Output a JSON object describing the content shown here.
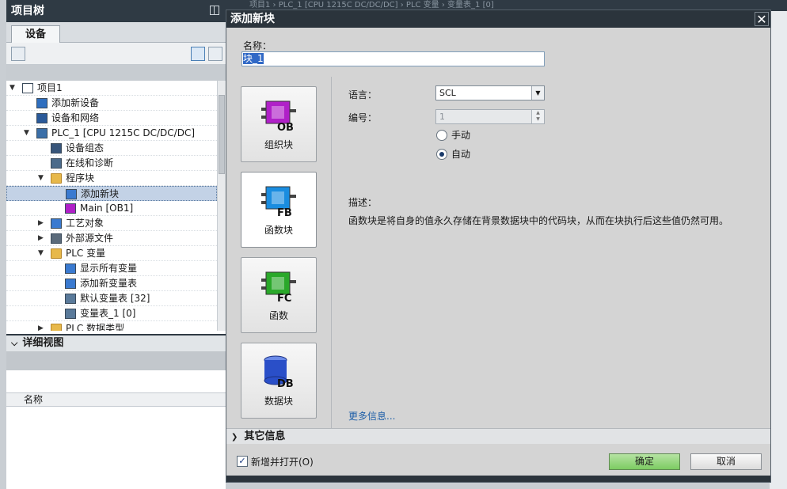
{
  "project_tree": {
    "title": "项目树",
    "tab_label": "设备",
    "items": [
      {
        "label": "项目1",
        "depth": 0,
        "expander": "▼",
        "icon": "project-icon"
      },
      {
        "label": "添加新设备",
        "depth": 1,
        "expander": "",
        "icon": "add-device-icon"
      },
      {
        "label": "设备和网络",
        "depth": 1,
        "expander": "",
        "icon": "network-icon"
      },
      {
        "label": "PLC_1 [CPU 1215C DC/DC/DC]",
        "depth": 1,
        "expander": "▼",
        "icon": "plc-icon"
      },
      {
        "label": "设备组态",
        "depth": 2,
        "expander": "",
        "icon": "device-config-icon"
      },
      {
        "label": "在线和诊断",
        "depth": 2,
        "expander": "",
        "icon": "diagnostics-icon"
      },
      {
        "label": "程序块",
        "depth": 2,
        "expander": "▼",
        "icon": "folder-icon"
      },
      {
        "label": "添加新块",
        "depth": 3,
        "expander": "",
        "icon": "add-block-icon",
        "selected": true
      },
      {
        "label": "Main [OB1]",
        "depth": 3,
        "expander": "",
        "icon": "ob-block-icon"
      },
      {
        "label": "工艺对象",
        "depth": 2,
        "expander": "▶",
        "icon": "technology-icon"
      },
      {
        "label": "外部源文件",
        "depth": 2,
        "expander": "▶",
        "icon": "source-file-icon"
      },
      {
        "label": "PLC 变量",
        "depth": 2,
        "expander": "▼",
        "icon": "folder-icon"
      },
      {
        "label": "显示所有变量",
        "depth": 3,
        "expander": "",
        "icon": "tags-icon"
      },
      {
        "label": "添加新变量表",
        "depth": 3,
        "expander": "",
        "icon": "add-tag-table-icon"
      },
      {
        "label": "默认变量表 [32]",
        "depth": 3,
        "expander": "",
        "icon": "tag-table-icon"
      },
      {
        "label": "变量表_1 [0]",
        "depth": 3,
        "expander": "",
        "icon": "tag-table-icon"
      },
      {
        "label": "PLC 数据类型",
        "depth": 2,
        "expander": "▶",
        "icon": "folder-icon"
      }
    ]
  },
  "detail_view": {
    "title": "详细视图",
    "column_name": "名称"
  },
  "background_breadcrumb": "项目1 › PLC_1 [CPU 1215C DC/DC/DC] › PLC 变量 › 变量表_1 [0]",
  "dialog": {
    "title": "添加新块",
    "close": "✕",
    "name_label": "名称：",
    "name_value": "块_1",
    "blocks": [
      {
        "label": "组织块",
        "code": "OB",
        "color": "#b020c8",
        "active": false
      },
      {
        "label": "函数块",
        "code": "FB",
        "color": "#1a8de0",
        "active": true
      },
      {
        "label": "函数",
        "code": "FC",
        "color": "#2aa82a",
        "active": false
      },
      {
        "label": "数据块",
        "code": "DB",
        "color": "#2a4fc8",
        "active": false
      }
    ],
    "language_label": "语言：",
    "language_value": "SCL",
    "number_label": "编号：",
    "number_value": "1",
    "radio_manual": "手动",
    "radio_auto": "自动",
    "description_label": "描述：",
    "description_text": "函数块是将自身的值永久存储在背景数据块中的代码块，从而在块执行后这些值仍然可用。",
    "more_info": "更多信息...",
    "other_info": "其它信息",
    "checkbox_label": "新增并打开(O)",
    "ok": "确定",
    "cancel": "取消"
  }
}
